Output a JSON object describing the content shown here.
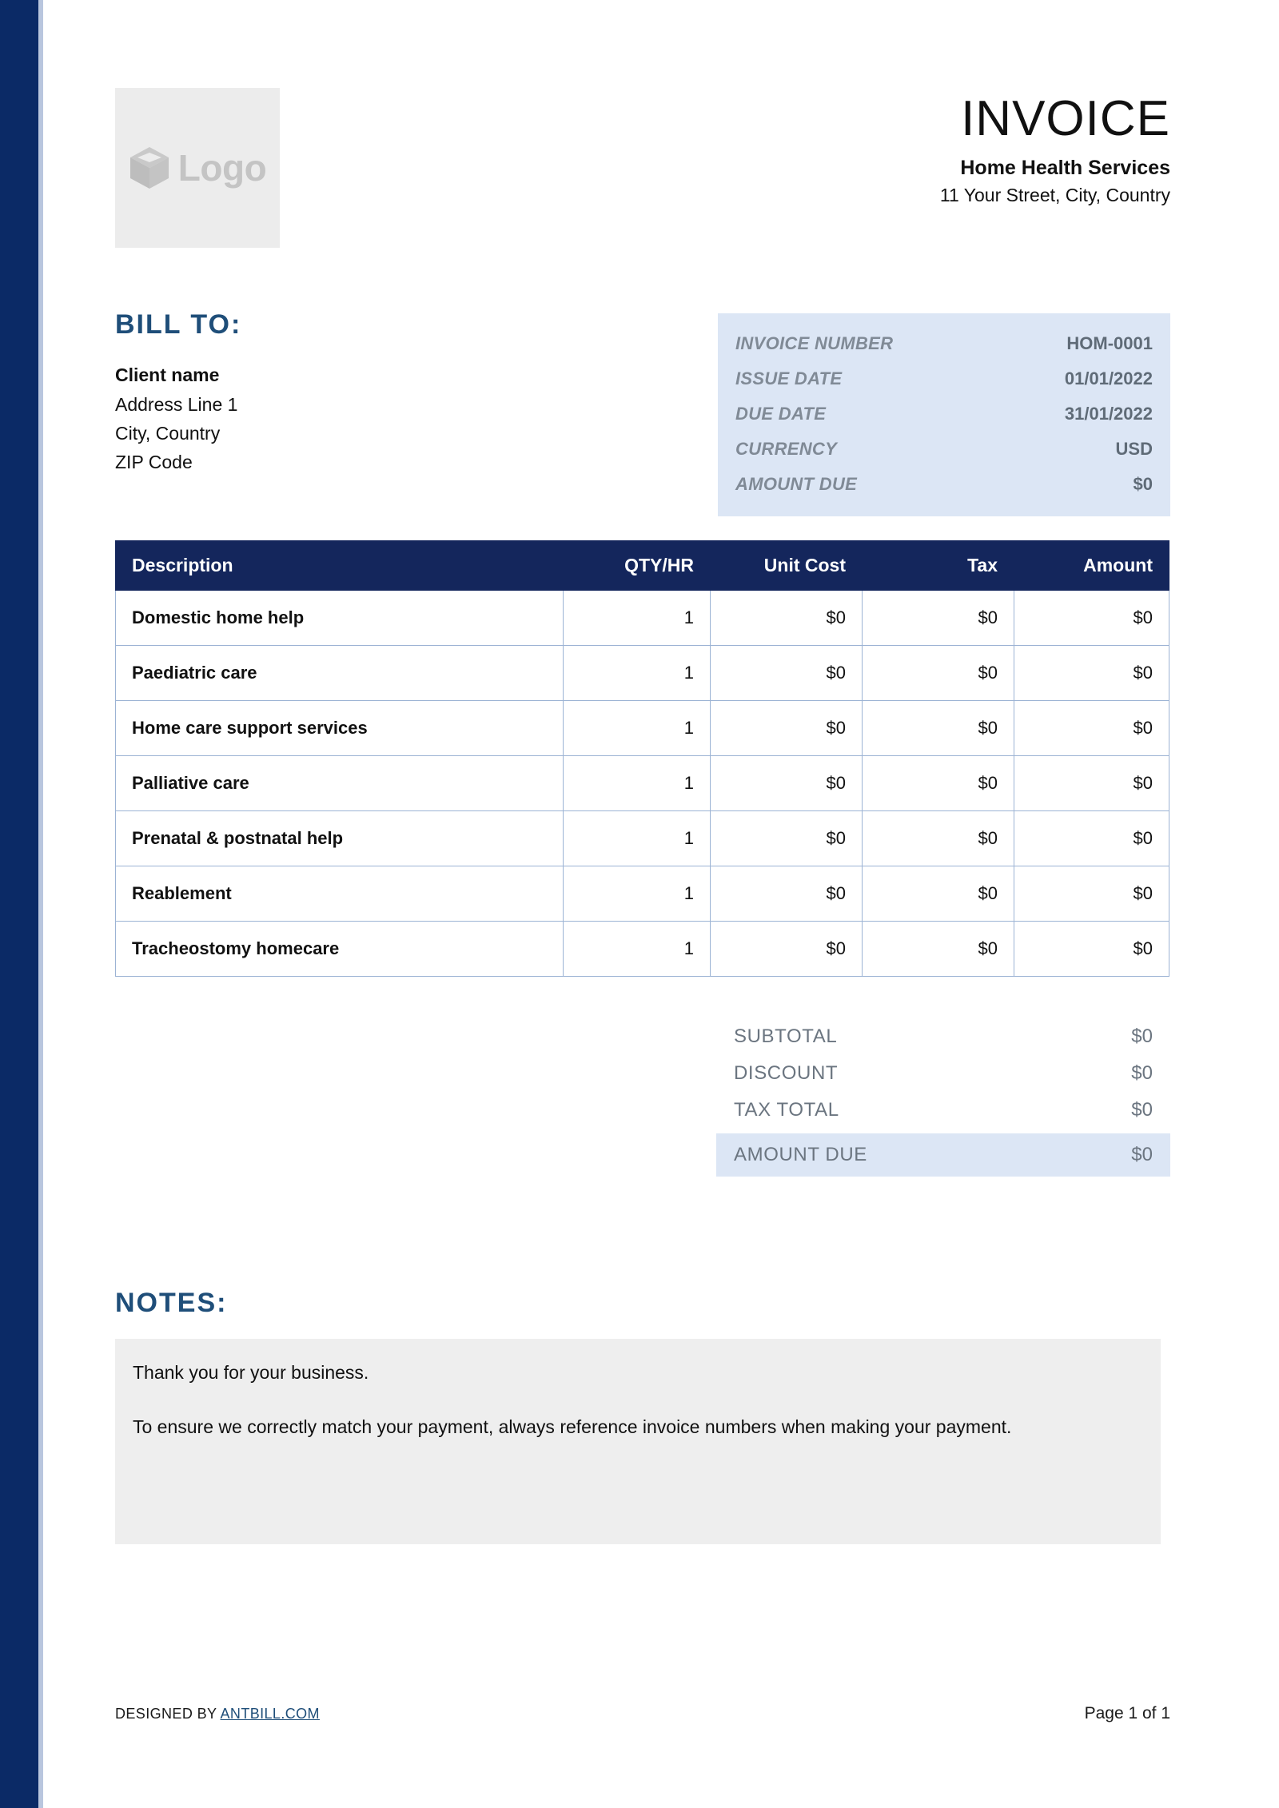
{
  "colors": {
    "stripe": "#0b2a66",
    "accent_heading": "#1f4e79",
    "table_header": "#14265c",
    "panel_blue": "#dce6f5",
    "notes_bg": "#eeeeee"
  },
  "logo": {
    "icon": "cube-icon",
    "text": "Logo"
  },
  "header": {
    "title": "INVOICE",
    "company_name": "Home Health Services",
    "company_address": "11 Your Street, City, Country"
  },
  "bill_to": {
    "heading": "BILL TO:",
    "client_name": "Client name",
    "address_lines": [
      "Address Line 1",
      "City, Country",
      "ZIP Code"
    ]
  },
  "invoice_details": [
    {
      "label": "INVOICE NUMBER",
      "value": "HOM-0001"
    },
    {
      "label": "ISSUE DATE",
      "value": "01/01/2022"
    },
    {
      "label": "DUE DATE",
      "value": "31/01/2022"
    },
    {
      "label": "CURRENCY",
      "value": "USD"
    },
    {
      "label": "AMOUNT DUE",
      "value": "$0"
    }
  ],
  "items_table": {
    "columns": [
      "Description",
      "QTY/HR",
      "Unit Cost",
      "Tax",
      "Amount"
    ],
    "rows": [
      {
        "description": "Domestic home help",
        "qty": "1",
        "unit_cost": "$0",
        "tax": "$0",
        "amount": "$0"
      },
      {
        "description": "Paediatric care",
        "qty": "1",
        "unit_cost": "$0",
        "tax": "$0",
        "amount": "$0"
      },
      {
        "description": "Home care support services",
        "qty": "1",
        "unit_cost": "$0",
        "tax": "$0",
        "amount": "$0"
      },
      {
        "description": "Palliative care",
        "qty": "1",
        "unit_cost": "$0",
        "tax": "$0",
        "amount": "$0"
      },
      {
        "description": "Prenatal & postnatal help",
        "qty": "1",
        "unit_cost": "$0",
        "tax": "$0",
        "amount": "$0"
      },
      {
        "description": "Reablement",
        "qty": "1",
        "unit_cost": "$0",
        "tax": "$0",
        "amount": "$0"
      },
      {
        "description": "Tracheostomy homecare",
        "qty": "1",
        "unit_cost": "$0",
        "tax": "$0",
        "amount": "$0"
      }
    ]
  },
  "totals": [
    {
      "label": "SUBTOTAL",
      "value": "$0"
    },
    {
      "label": "DISCOUNT",
      "value": "$0"
    },
    {
      "label": "TAX TOTAL",
      "value": "$0"
    },
    {
      "label": "AMOUNT DUE",
      "value": "$0"
    }
  ],
  "notes": {
    "heading": "NOTES:",
    "line1": "Thank you for your business.",
    "line2": "To ensure we correctly match your payment, always reference invoice numbers when making your payment."
  },
  "footer": {
    "designed_by_prefix": "DESIGNED BY ",
    "designed_by_link": "ANTBILL.COM",
    "page_label": "Page 1 of 1"
  }
}
